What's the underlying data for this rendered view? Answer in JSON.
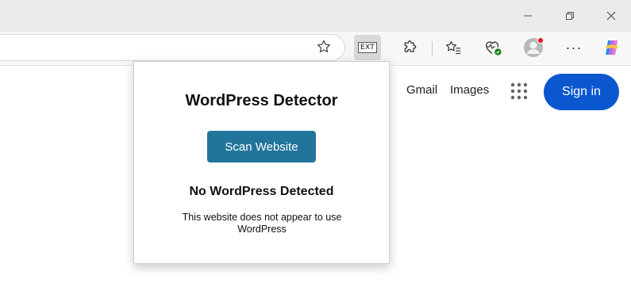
{
  "window": {
    "minimize_icon": "minimize-icon",
    "restore_icon": "restore-icon",
    "close_icon": "close-icon"
  },
  "toolbar": {
    "extension_label": "EXT",
    "more_label": "···",
    "icons": [
      "star-icon",
      "puzzle-icon",
      "favorites-icon",
      "browser-health-icon",
      "profile-avatar",
      "more-icon",
      "copilot-icon"
    ]
  },
  "page": {
    "gmail": "Gmail",
    "images": "Images",
    "sign_in": "Sign in",
    "accent_color": "#0b57d0"
  },
  "popup": {
    "title": "WordPress Detector",
    "scan_button": "Scan Website",
    "result_title": "No WordPress Detected",
    "result_message": "This website does not appear to use WordPress",
    "button_color": "#21759b"
  }
}
